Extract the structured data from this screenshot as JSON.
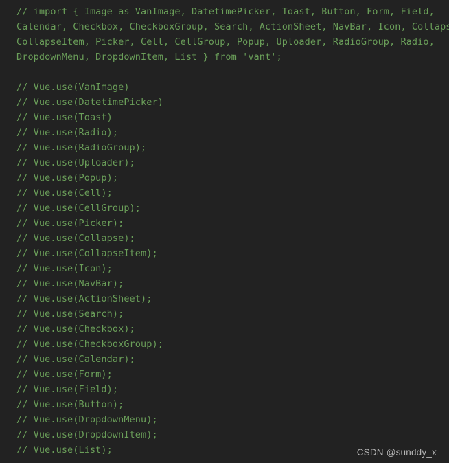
{
  "editor": {
    "background_color": "#222222",
    "comment_color": "#6a9e59",
    "language": "javascript",
    "lines": [
      "// import { Image as VanImage, DatetimePicker, Toast, Button, Form, Field,",
      "Calendar, Checkbox, CheckboxGroup, Search, ActionSheet, NavBar, Icon, Collapse,",
      "CollapseItem, Picker, Cell, CellGroup, Popup, Uploader, RadioGroup, Radio,",
      "DropdownMenu, DropdownItem, List } from 'vant';",
      "",
      "// Vue.use(VanImage)",
      "// Vue.use(DatetimePicker)",
      "// Vue.use(Toast)",
      "// Vue.use(Radio);",
      "// Vue.use(RadioGroup);",
      "// Vue.use(Uploader);",
      "// Vue.use(Popup);",
      "// Vue.use(Cell);",
      "// Vue.use(CellGroup);",
      "// Vue.use(Picker);",
      "// Vue.use(Collapse);",
      "// Vue.use(CollapseItem);",
      "// Vue.use(Icon);",
      "// Vue.use(NavBar);",
      "// Vue.use(ActionSheet);",
      "// Vue.use(Search);",
      "// Vue.use(Checkbox);",
      "// Vue.use(CheckboxGroup);",
      "// Vue.use(Calendar);",
      "// Vue.use(Form);",
      "// Vue.use(Field);",
      "// Vue.use(Button);",
      "// Vue.use(DropdownMenu);",
      "// Vue.use(DropdownItem);",
      "// Vue.use(List);"
    ]
  },
  "watermark": {
    "text": "CSDN @sunddy_x",
    "color": "#b5b5b5"
  }
}
